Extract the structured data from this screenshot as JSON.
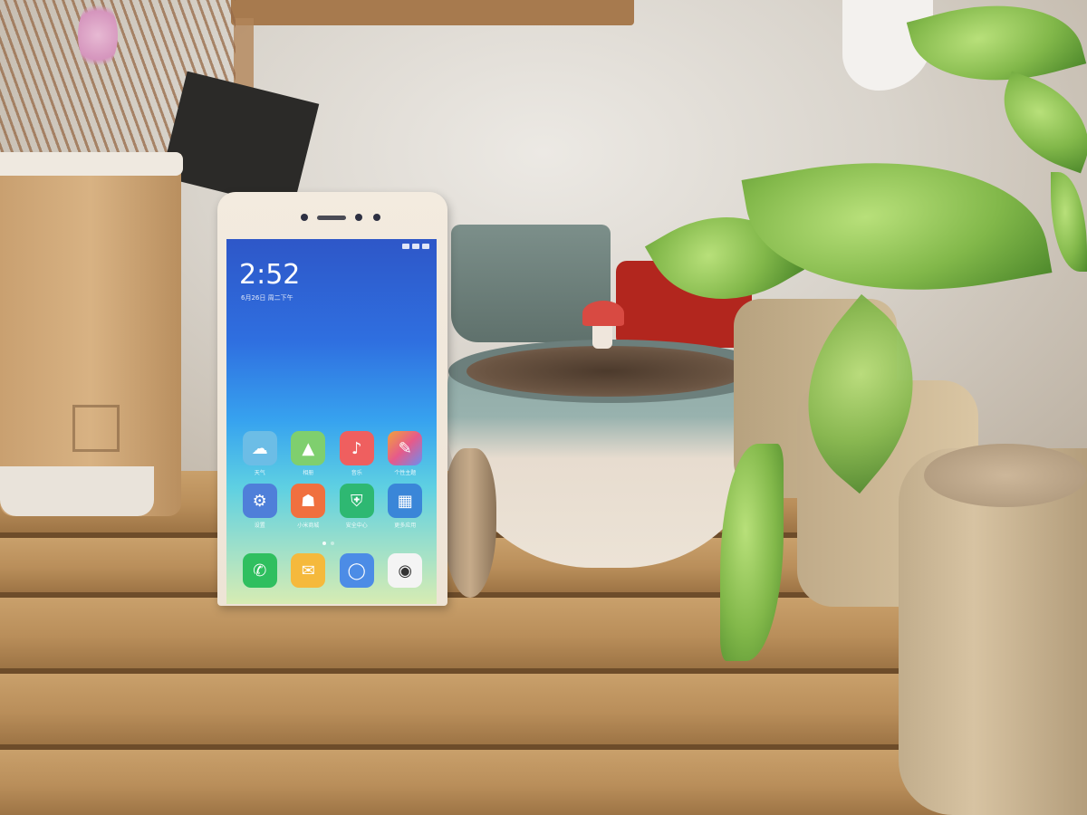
{
  "phone": {
    "time": "2:52",
    "date": "6月26日 周二下午",
    "apps": [
      {
        "label": "天气",
        "icon": "weather-icon",
        "color": "#5fb6e6",
        "glyph": "☁"
      },
      {
        "label": "相册",
        "icon": "gallery-icon",
        "color": "#7fcf6e",
        "glyph": "▲"
      },
      {
        "label": "音乐",
        "icon": "music-icon",
        "color": "#ef5f5f",
        "glyph": "♪"
      },
      {
        "label": "个性主题",
        "icon": "themes-icon",
        "color": "#f2a13c",
        "glyph": "✎"
      },
      {
        "label": "设置",
        "icon": "settings-icon",
        "color": "#4f7fd9",
        "glyph": "⚙"
      },
      {
        "label": "小米商城",
        "icon": "mi-store-icon",
        "color": "#f0703f",
        "glyph": "☗"
      },
      {
        "label": "安全中心",
        "icon": "security-icon",
        "color": "#2eb872",
        "glyph": "⛨"
      },
      {
        "label": "更多应用",
        "icon": "more-apps-icon",
        "color": "#3a86d8",
        "glyph": "▦"
      }
    ],
    "dock": [
      {
        "icon": "phone-icon",
        "color": "#2fbf5f",
        "glyph": "✆"
      },
      {
        "icon": "messages-icon",
        "color": "#f5b93c",
        "glyph": "✉"
      },
      {
        "icon": "browser-icon",
        "color": "#4c8ce6",
        "glyph": "◯"
      },
      {
        "icon": "camera-icon",
        "color": "#f4f4f4",
        "glyph": "◉"
      }
    ]
  }
}
